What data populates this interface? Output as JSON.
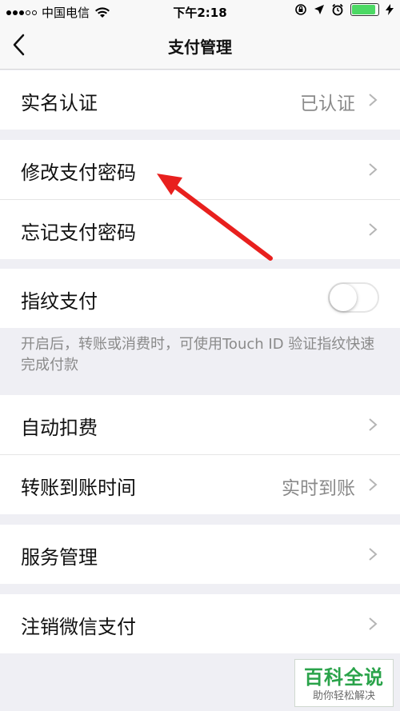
{
  "status_bar": {
    "carrier": "中国电信",
    "time": "下午2:18",
    "battery_level": 0.95
  },
  "nav": {
    "title": "支付管理"
  },
  "groups": {
    "identity": {
      "label": "实名认证",
      "value": "已认证"
    },
    "password": {
      "change_label": "修改支付密码",
      "forgot_label": "忘记支付密码"
    },
    "fingerprint": {
      "label": "指纹支付",
      "toggle_on": false,
      "description": "开启后，转账或消费时，可使用Touch ID 验证指纹快速完成付款"
    },
    "billing": {
      "auto_deduct_label": "自动扣费",
      "transfer_label": "转账到账时间",
      "transfer_value": "实时到账"
    },
    "service": {
      "label": "服务管理"
    },
    "cancel": {
      "label": "注销微信支付"
    }
  },
  "watermark": {
    "title": "百科全说",
    "subtitle": "助你轻松解决"
  },
  "colors": {
    "accent_arrow": "#e8201e",
    "background": "#efeff4",
    "watermark_green": "#2aa34a"
  }
}
